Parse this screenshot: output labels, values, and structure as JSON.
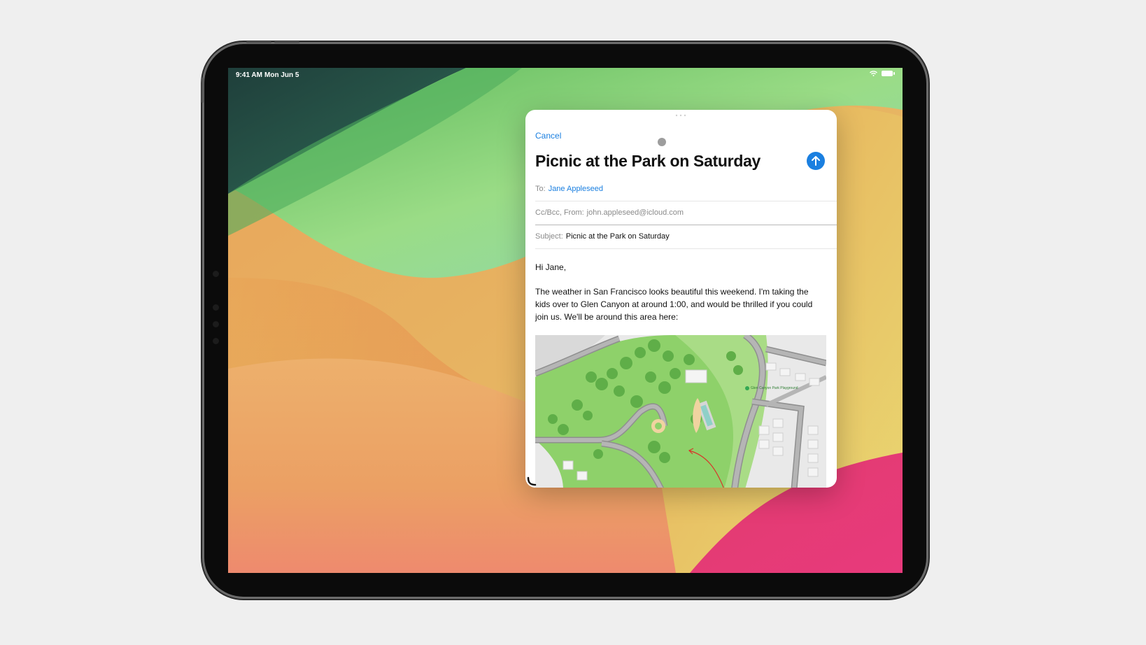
{
  "status_bar": {
    "time": "9:41 AM",
    "date": "Mon Jun 5"
  },
  "compose": {
    "cancel_label": "Cancel",
    "title": "Picnic at the Park on Saturday",
    "send_icon": "arrow-up-circle-icon",
    "to_label": "To:",
    "to_value": "Jane Appleseed",
    "ccbcc_label": "Cc/Bcc, From:",
    "from_value": "john.appleseed@icloud.com",
    "subject_label": "Subject:",
    "subject_value": "Picnic at the Park on Saturday",
    "greeting": "Hi Jane,",
    "body": "The weather in San Francisco looks beautiful this weekend. I'm taking the kids over to Glen Canyon at around 1:00, and would be thrilled if you could join us. We'll be around this area here:"
  },
  "map": {
    "poi_label": "Glen Canyon Park Playground"
  },
  "colors": {
    "accent": "#1a7fe0",
    "park_green": "#8ed16a",
    "road_gray": "#8f8f8f",
    "annotation_red": "#d8352a"
  }
}
